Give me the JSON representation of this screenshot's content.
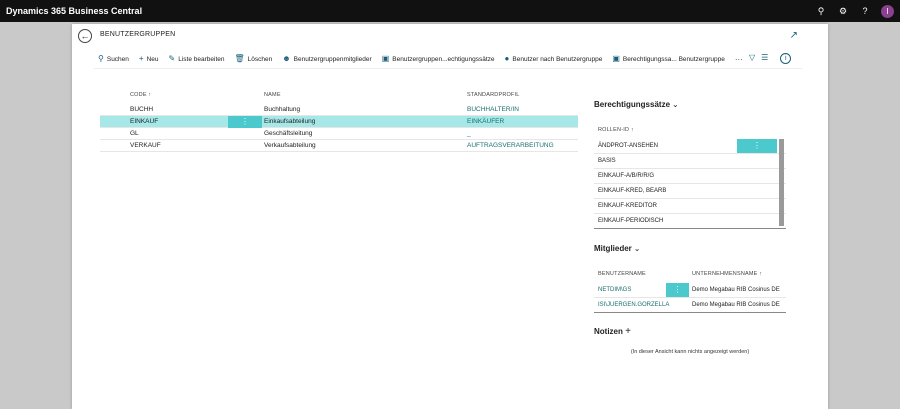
{
  "app": {
    "title": "Dynamics 365 Business Central",
    "avatar_initial": "I"
  },
  "topbar_icons": [
    "search-icon",
    "settings-icon",
    "help-icon"
  ],
  "page": {
    "title": "BENUTZERGRUPPEN"
  },
  "actions": [
    {
      "label": "Suchen",
      "icon": "search-icon"
    },
    {
      "label": "Neu",
      "icon": "plus-icon"
    },
    {
      "label": "Liste bearbeiten",
      "icon": "edit-list-icon"
    },
    {
      "label": "Löschen",
      "icon": "delete-icon"
    },
    {
      "label": "Benutzergruppenmitglieder",
      "icon": "group-icon"
    },
    {
      "label": "Benutzergruppen...echtigungssätze",
      "icon": "permission-icon"
    },
    {
      "label": "Benutzer nach Benutzergruppe",
      "icon": "user-icon"
    },
    {
      "label": "Berechtigungssa... Benutzergruppe",
      "icon": "permission-icon"
    }
  ],
  "more_label": "···",
  "list": {
    "columns": {
      "code": "CODE ↑",
      "name": "NAME",
      "profile": "STANDARDPROFIL"
    },
    "rows": [
      {
        "code": "BUCHH",
        "name": "Buchhaltung",
        "profile": "BUCHHALTER/IN"
      },
      {
        "code": "EINKAUF",
        "name": "Einkaufsabteilung",
        "profile": "EINKÄUFER"
      },
      {
        "code": "GL",
        "name": "Geschäftsleitung",
        "profile": "_"
      },
      {
        "code": "VERKAUF",
        "name": "Verkaufsabteilung",
        "profile": "AUFTRAGSVERARBEITUNG"
      }
    ],
    "row_menu": "⋮"
  },
  "permissions": {
    "title": "Berechtigungssätze",
    "column": "ROLLEN-ID ↑",
    "rows": [
      "ÄNDPROT-ANSEHEN",
      "BASIS",
      "EINKAUF-A/B/R/R/G",
      "EINKAUF-KRED, BEARB",
      "EINKAUF-KREDITOR",
      "EINKAUF-PERIODISCH"
    ]
  },
  "members": {
    "title": "Mitglieder",
    "columns": {
      "user": "BENUTZERNAME",
      "company": "UNTERNEHMENSNAME ↑"
    },
    "rows": [
      {
        "user": "NETDIM\\GS",
        "company": "Demo Megabau RIB Cosinus DE"
      },
      {
        "user": "ISI\\JUERGEN.GORZELLA",
        "company": "Demo Megabau RIB Cosinus DE"
      }
    ]
  },
  "notes": {
    "title": "Notizen",
    "add": "+",
    "empty": "(In dieser Ansicht kann nichts angezeigt werden)"
  }
}
